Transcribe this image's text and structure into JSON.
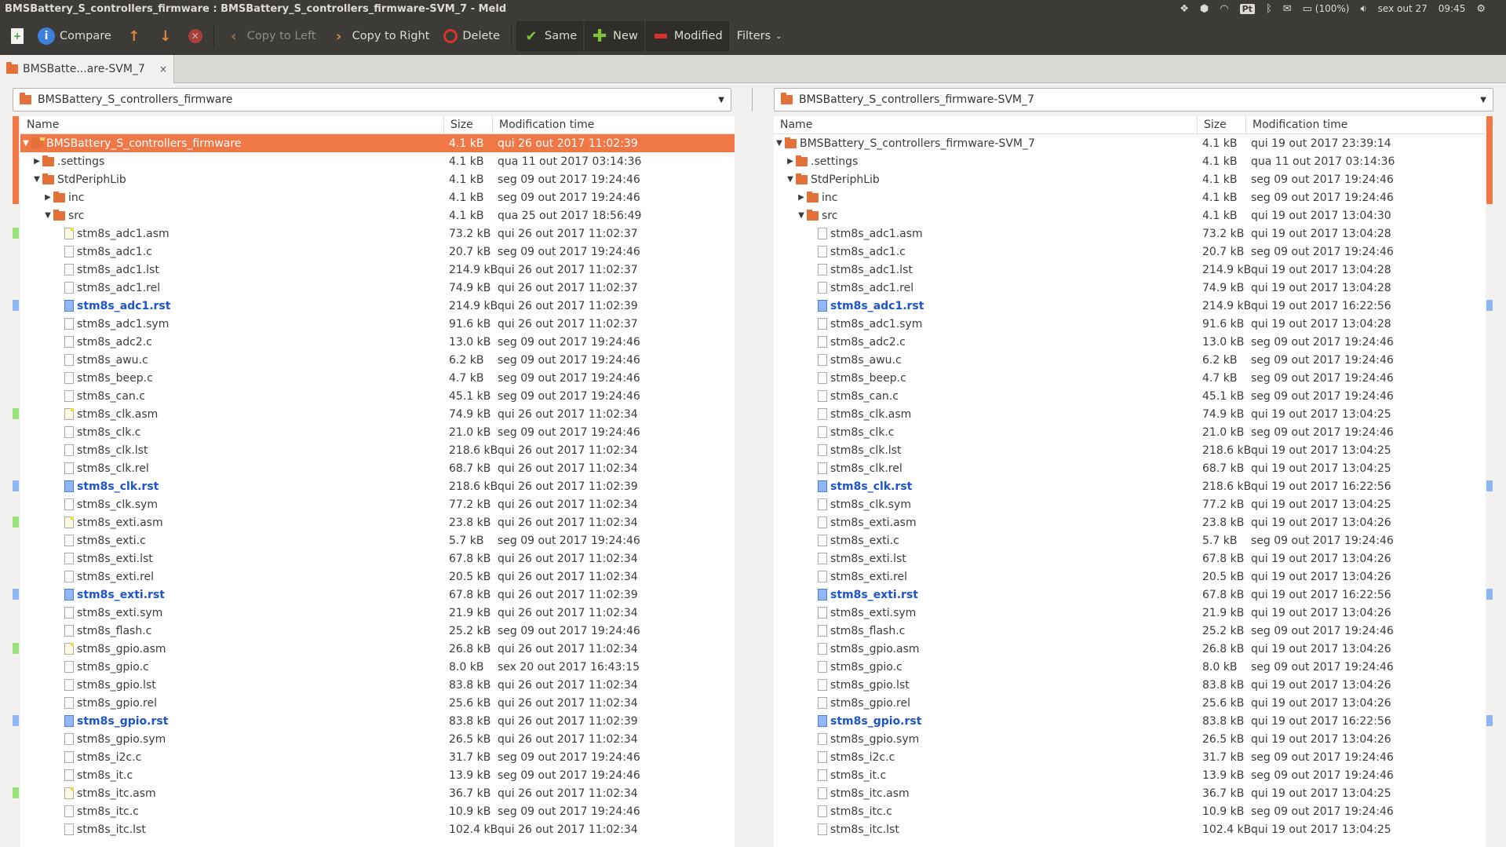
{
  "window": {
    "title": "BMSBattery_S_controllers_firmware : BMSBattery_S_controllers_firmware-SVM_7 - Meld"
  },
  "tray": {
    "keyboard": "Pt",
    "battery": "(100%)",
    "date": "sex out 27",
    "time": "09:45"
  },
  "toolbar": {
    "compare": "Compare",
    "copy_left": "Copy to Left",
    "copy_right": "Copy to Right",
    "delete": "Delete",
    "same": "Same",
    "new": "New",
    "modified": "Modified",
    "filters": "Filters"
  },
  "tab": {
    "label": "BMSBatte...are-SVM_7",
    "close": "×"
  },
  "left": {
    "path": "BMSBattery_S_controllers_firmware",
    "headers": {
      "name": "Name",
      "size": "Size",
      "time": "Modification time"
    },
    "rows": [
      {
        "level": 0,
        "kind": "folder",
        "expand": "open",
        "special": true,
        "selected": true,
        "name": "BMSBattery_S_controllers_firmware",
        "size": "4.1 kB",
        "time": "qui 26 out 2017 11:02:39"
      },
      {
        "level": 1,
        "kind": "folder",
        "expand": "closed",
        "name": ".settings",
        "size": "4.1 kB",
        "time": "qua 11 out 2017 03:14:36"
      },
      {
        "level": 1,
        "kind": "folder",
        "expand": "open",
        "name": "StdPeriphLib",
        "size": "4.1 kB",
        "time": "seg 09 out 2017 19:24:46"
      },
      {
        "level": 2,
        "kind": "folder",
        "expand": "closed",
        "name": "inc",
        "size": "4.1 kB",
        "time": "seg 09 out 2017 19:24:46"
      },
      {
        "level": 2,
        "kind": "folder",
        "expand": "open",
        "name": "src",
        "size": "4.1 kB",
        "time": "qua 25 out 2017 18:56:49"
      },
      {
        "level": 3,
        "kind": "new",
        "name": "stm8s_adc1.asm",
        "size": "73.2 kB",
        "time": "qui 26 out 2017 11:02:37"
      },
      {
        "level": 3,
        "kind": "same",
        "name": "stm8s_adc1.c",
        "size": "20.7 kB",
        "time": "seg 09 out 2017 19:24:46"
      },
      {
        "level": 3,
        "kind": "same",
        "name": "stm8s_adc1.lst",
        "size": "214.9 kB",
        "time": "qui 26 out 2017 11:02:37"
      },
      {
        "level": 3,
        "kind": "same",
        "name": "stm8s_adc1.rel",
        "size": "74.9 kB",
        "time": "qui 26 out 2017 11:02:37"
      },
      {
        "level": 3,
        "kind": "modified",
        "name": "stm8s_adc1.rst",
        "size": "214.9 kB",
        "time": "qui 26 out 2017 11:02:39"
      },
      {
        "level": 3,
        "kind": "same",
        "name": "stm8s_adc1.sym",
        "size": "91.6 kB",
        "time": "qui 26 out 2017 11:02:37"
      },
      {
        "level": 3,
        "kind": "same",
        "name": "stm8s_adc2.c",
        "size": "13.0 kB",
        "time": "seg 09 out 2017 19:24:46"
      },
      {
        "level": 3,
        "kind": "same",
        "name": "stm8s_awu.c",
        "size": "6.2 kB",
        "time": "seg 09 out 2017 19:24:46"
      },
      {
        "level": 3,
        "kind": "same",
        "name": "stm8s_beep.c",
        "size": "4.7 kB",
        "time": "seg 09 out 2017 19:24:46"
      },
      {
        "level": 3,
        "kind": "same",
        "name": "stm8s_can.c",
        "size": "45.1 kB",
        "time": "seg 09 out 2017 19:24:46"
      },
      {
        "level": 3,
        "kind": "new",
        "name": "stm8s_clk.asm",
        "size": "74.9 kB",
        "time": "qui 26 out 2017 11:02:34"
      },
      {
        "level": 3,
        "kind": "same",
        "name": "stm8s_clk.c",
        "size": "21.0 kB",
        "time": "seg 09 out 2017 19:24:46"
      },
      {
        "level": 3,
        "kind": "same",
        "name": "stm8s_clk.lst",
        "size": "218.6 kB",
        "time": "qui 26 out 2017 11:02:34"
      },
      {
        "level": 3,
        "kind": "same",
        "name": "stm8s_clk.rel",
        "size": "68.7 kB",
        "time": "qui 26 out 2017 11:02:34"
      },
      {
        "level": 3,
        "kind": "modified",
        "name": "stm8s_clk.rst",
        "size": "218.6 kB",
        "time": "qui 26 out 2017 11:02:39"
      },
      {
        "level": 3,
        "kind": "same",
        "name": "stm8s_clk.sym",
        "size": "77.2 kB",
        "time": "qui 26 out 2017 11:02:34"
      },
      {
        "level": 3,
        "kind": "new",
        "name": "stm8s_exti.asm",
        "size": "23.8 kB",
        "time": "qui 26 out 2017 11:02:34"
      },
      {
        "level": 3,
        "kind": "same",
        "name": "stm8s_exti.c",
        "size": "5.7 kB",
        "time": "seg 09 out 2017 19:24:46"
      },
      {
        "level": 3,
        "kind": "same",
        "name": "stm8s_exti.lst",
        "size": "67.8 kB",
        "time": "qui 26 out 2017 11:02:34"
      },
      {
        "level": 3,
        "kind": "same",
        "name": "stm8s_exti.rel",
        "size": "20.5 kB",
        "time": "qui 26 out 2017 11:02:34"
      },
      {
        "level": 3,
        "kind": "modified",
        "name": "stm8s_exti.rst",
        "size": "67.8 kB",
        "time": "qui 26 out 2017 11:02:39"
      },
      {
        "level": 3,
        "kind": "same",
        "name": "stm8s_exti.sym",
        "size": "21.9 kB",
        "time": "qui 26 out 2017 11:02:34"
      },
      {
        "level": 3,
        "kind": "same",
        "name": "stm8s_flash.c",
        "size": "25.2 kB",
        "time": "seg 09 out 2017 19:24:46"
      },
      {
        "level": 3,
        "kind": "new",
        "name": "stm8s_gpio.asm",
        "size": "26.8 kB",
        "time": "qui 26 out 2017 11:02:34"
      },
      {
        "level": 3,
        "kind": "same",
        "name": "stm8s_gpio.c",
        "size": "8.0 kB",
        "time": "sex 20 out 2017 16:43:15"
      },
      {
        "level": 3,
        "kind": "same",
        "name": "stm8s_gpio.lst",
        "size": "83.8 kB",
        "time": "qui 26 out 2017 11:02:34"
      },
      {
        "level": 3,
        "kind": "same",
        "name": "stm8s_gpio.rel",
        "size": "25.6 kB",
        "time": "qui 26 out 2017 11:02:34"
      },
      {
        "level": 3,
        "kind": "modified",
        "name": "stm8s_gpio.rst",
        "size": "83.8 kB",
        "time": "qui 26 out 2017 11:02:39"
      },
      {
        "level": 3,
        "kind": "same",
        "name": "stm8s_gpio.sym",
        "size": "26.5 kB",
        "time": "qui 26 out 2017 11:02:34"
      },
      {
        "level": 3,
        "kind": "same",
        "name": "stm8s_i2c.c",
        "size": "31.7 kB",
        "time": "seg 09 out 2017 19:24:46"
      },
      {
        "level": 3,
        "kind": "same",
        "name": "stm8s_it.c",
        "size": "13.9 kB",
        "time": "seg 09 out 2017 19:24:46"
      },
      {
        "level": 3,
        "kind": "new",
        "name": "stm8s_itc.asm",
        "size": "36.7 kB",
        "time": "qui 26 out 2017 11:02:34"
      },
      {
        "level": 3,
        "kind": "same",
        "name": "stm8s_itc.c",
        "size": "10.9 kB",
        "time": "seg 09 out 2017 19:24:46"
      },
      {
        "level": 3,
        "kind": "same",
        "name": "stm8s_itc.lst",
        "size": "102.4 kB",
        "time": "qui 26 out 2017 11:02:34"
      }
    ]
  },
  "right": {
    "path": "BMSBattery_S_controllers_firmware-SVM_7",
    "headers": {
      "name": "Name",
      "size": "Size",
      "time": "Modification time"
    },
    "rows": [
      {
        "level": 0,
        "kind": "folder",
        "expand": "open",
        "name": "BMSBattery_S_controllers_firmware-SVM_7",
        "size": "4.1 kB",
        "time": "qui 19 out 2017 23:39:14"
      },
      {
        "level": 1,
        "kind": "folder",
        "expand": "closed",
        "name": ".settings",
        "size": "4.1 kB",
        "time": "qua 11 out 2017 03:14:36"
      },
      {
        "level": 1,
        "kind": "folder",
        "expand": "open",
        "name": "StdPeriphLib",
        "size": "4.1 kB",
        "time": "seg 09 out 2017 19:24:46"
      },
      {
        "level": 2,
        "kind": "folder",
        "expand": "closed",
        "name": "inc",
        "size": "4.1 kB",
        "time": "seg 09 out 2017 19:24:46"
      },
      {
        "level": 2,
        "kind": "folder",
        "expand": "open",
        "name": "src",
        "size": "4.1 kB",
        "time": "qui 19 out 2017 13:04:30"
      },
      {
        "level": 3,
        "kind": "same",
        "name": "stm8s_adc1.asm",
        "size": "73.2 kB",
        "time": "qui 19 out 2017 13:04:28"
      },
      {
        "level": 3,
        "kind": "same",
        "name": "stm8s_adc1.c",
        "size": "20.7 kB",
        "time": "seg 09 out 2017 19:24:46"
      },
      {
        "level": 3,
        "kind": "same",
        "name": "stm8s_adc1.lst",
        "size": "214.9 kB",
        "time": "qui 19 out 2017 13:04:28"
      },
      {
        "level": 3,
        "kind": "same",
        "name": "stm8s_adc1.rel",
        "size": "74.9 kB",
        "time": "qui 19 out 2017 13:04:28"
      },
      {
        "level": 3,
        "kind": "modified",
        "name": "stm8s_adc1.rst",
        "size": "214.9 kB",
        "time": "qui 19 out 2017 16:22:56"
      },
      {
        "level": 3,
        "kind": "same",
        "name": "stm8s_adc1.sym",
        "size": "91.6 kB",
        "time": "qui 19 out 2017 13:04:28"
      },
      {
        "level": 3,
        "kind": "same",
        "name": "stm8s_adc2.c",
        "size": "13.0 kB",
        "time": "seg 09 out 2017 19:24:46"
      },
      {
        "level": 3,
        "kind": "same",
        "name": "stm8s_awu.c",
        "size": "6.2 kB",
        "time": "seg 09 out 2017 19:24:46"
      },
      {
        "level": 3,
        "kind": "same",
        "name": "stm8s_beep.c",
        "size": "4.7 kB",
        "time": "seg 09 out 2017 19:24:46"
      },
      {
        "level": 3,
        "kind": "same",
        "name": "stm8s_can.c",
        "size": "45.1 kB",
        "time": "seg 09 out 2017 19:24:46"
      },
      {
        "level": 3,
        "kind": "same",
        "name": "stm8s_clk.asm",
        "size": "74.9 kB",
        "time": "qui 19 out 2017 13:04:25"
      },
      {
        "level": 3,
        "kind": "same",
        "name": "stm8s_clk.c",
        "size": "21.0 kB",
        "time": "seg 09 out 2017 19:24:46"
      },
      {
        "level": 3,
        "kind": "same",
        "name": "stm8s_clk.lst",
        "size": "218.6 kB",
        "time": "qui 19 out 2017 13:04:25"
      },
      {
        "level": 3,
        "kind": "same",
        "name": "stm8s_clk.rel",
        "size": "68.7 kB",
        "time": "qui 19 out 2017 13:04:25"
      },
      {
        "level": 3,
        "kind": "modified",
        "name": "stm8s_clk.rst",
        "size": "218.6 kB",
        "time": "qui 19 out 2017 16:22:56"
      },
      {
        "level": 3,
        "kind": "same",
        "name": "stm8s_clk.sym",
        "size": "77.2 kB",
        "time": "qui 19 out 2017 13:04:25"
      },
      {
        "level": 3,
        "kind": "same",
        "name": "stm8s_exti.asm",
        "size": "23.8 kB",
        "time": "qui 19 out 2017 13:04:26"
      },
      {
        "level": 3,
        "kind": "same",
        "name": "stm8s_exti.c",
        "size": "5.7 kB",
        "time": "seg 09 out 2017 19:24:46"
      },
      {
        "level": 3,
        "kind": "same",
        "name": "stm8s_exti.lst",
        "size": "67.8 kB",
        "time": "qui 19 out 2017 13:04:26"
      },
      {
        "level": 3,
        "kind": "same",
        "name": "stm8s_exti.rel",
        "size": "20.5 kB",
        "time": "qui 19 out 2017 13:04:26"
      },
      {
        "level": 3,
        "kind": "modified",
        "name": "stm8s_exti.rst",
        "size": "67.8 kB",
        "time": "qui 19 out 2017 16:22:56"
      },
      {
        "level": 3,
        "kind": "same",
        "name": "stm8s_exti.sym",
        "size": "21.9 kB",
        "time": "qui 19 out 2017 13:04:26"
      },
      {
        "level": 3,
        "kind": "same",
        "name": "stm8s_flash.c",
        "size": "25.2 kB",
        "time": "seg 09 out 2017 19:24:46"
      },
      {
        "level": 3,
        "kind": "same",
        "name": "stm8s_gpio.asm",
        "size": "26.8 kB",
        "time": "qui 19 out 2017 13:04:26"
      },
      {
        "level": 3,
        "kind": "same",
        "name": "stm8s_gpio.c",
        "size": "8.0 kB",
        "time": "seg 09 out 2017 19:24:46"
      },
      {
        "level": 3,
        "kind": "same",
        "name": "stm8s_gpio.lst",
        "size": "83.8 kB",
        "time": "qui 19 out 2017 13:04:26"
      },
      {
        "level": 3,
        "kind": "same",
        "name": "stm8s_gpio.rel",
        "size": "25.6 kB",
        "time": "qui 19 out 2017 13:04:26"
      },
      {
        "level": 3,
        "kind": "modified",
        "name": "stm8s_gpio.rst",
        "size": "83.8 kB",
        "time": "qui 19 out 2017 16:22:56"
      },
      {
        "level": 3,
        "kind": "same",
        "name": "stm8s_gpio.sym",
        "size": "26.5 kB",
        "time": "qui 19 out 2017 13:04:26"
      },
      {
        "level": 3,
        "kind": "same",
        "name": "stm8s_i2c.c",
        "size": "31.7 kB",
        "time": "seg 09 out 2017 19:24:46"
      },
      {
        "level": 3,
        "kind": "same",
        "name": "stm8s_it.c",
        "size": "13.9 kB",
        "time": "seg 09 out 2017 19:24:46"
      },
      {
        "level": 3,
        "kind": "same",
        "name": "stm8s_itc.asm",
        "size": "36.7 kB",
        "time": "qui 19 out 2017 13:04:25"
      },
      {
        "level": 3,
        "kind": "same",
        "name": "stm8s_itc.c",
        "size": "10.9 kB",
        "time": "seg 09 out 2017 19:24:46"
      },
      {
        "level": 3,
        "kind": "same",
        "name": "stm8s_itc.lst",
        "size": "102.4 kB",
        "time": "qui 19 out 2017 13:04:25"
      }
    ]
  },
  "colors": {
    "selected": "#f07746",
    "modified": "#1d55c9",
    "folder": "#e2713a",
    "toolbar": "#3c3b37",
    "new_mark": "#99e27a",
    "changed_mark": "#8fb6f2"
  }
}
